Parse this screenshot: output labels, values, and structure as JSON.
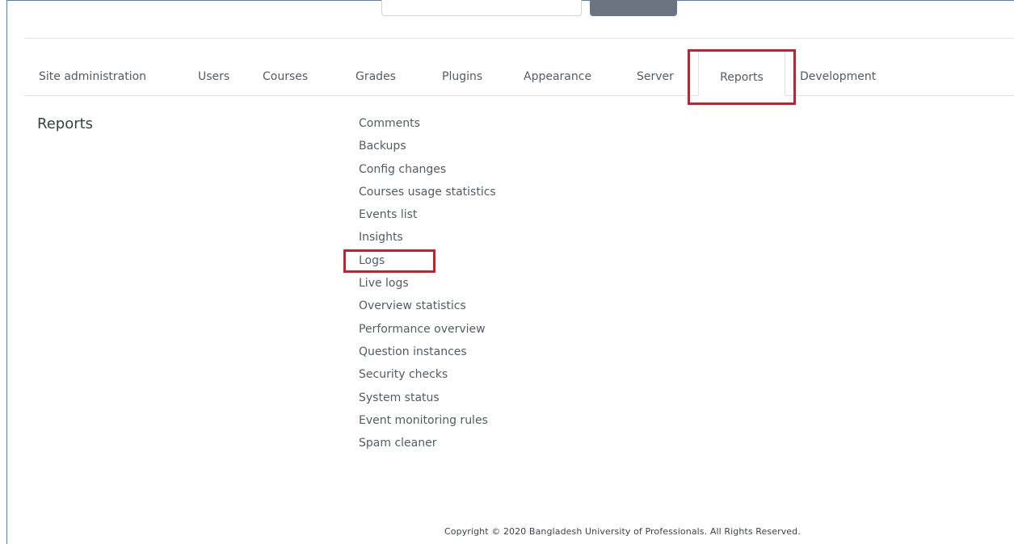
{
  "header": {
    "search_placeholder": ""
  },
  "tabs": [
    {
      "label": "Site administration",
      "active": false
    },
    {
      "label": "Users",
      "active": false
    },
    {
      "label": "Courses",
      "active": false
    },
    {
      "label": "Grades",
      "active": false
    },
    {
      "label": "Plugins",
      "active": false
    },
    {
      "label": "Appearance",
      "active": false
    },
    {
      "label": "Server",
      "active": false
    },
    {
      "label": "Reports",
      "active": true
    },
    {
      "label": "Development",
      "active": false
    }
  ],
  "section": {
    "heading": "Reports",
    "links": [
      "Comments",
      "Backups",
      "Config changes",
      "Courses usage statistics",
      "Events list",
      "Insights",
      "Logs",
      "Live logs",
      "Overview statistics",
      "Performance overview",
      "Question instances",
      "Security checks",
      "System status",
      "Event monitoring rules",
      "Spam cleaner"
    ]
  },
  "footer": {
    "copyright": "Copyright © 2020 Bangladesh University of Professionals. All Rights Reserved."
  },
  "colors": {
    "highlight": "#c8202f",
    "frame_border": "#4f7fc9",
    "link_text": "#555b61"
  }
}
